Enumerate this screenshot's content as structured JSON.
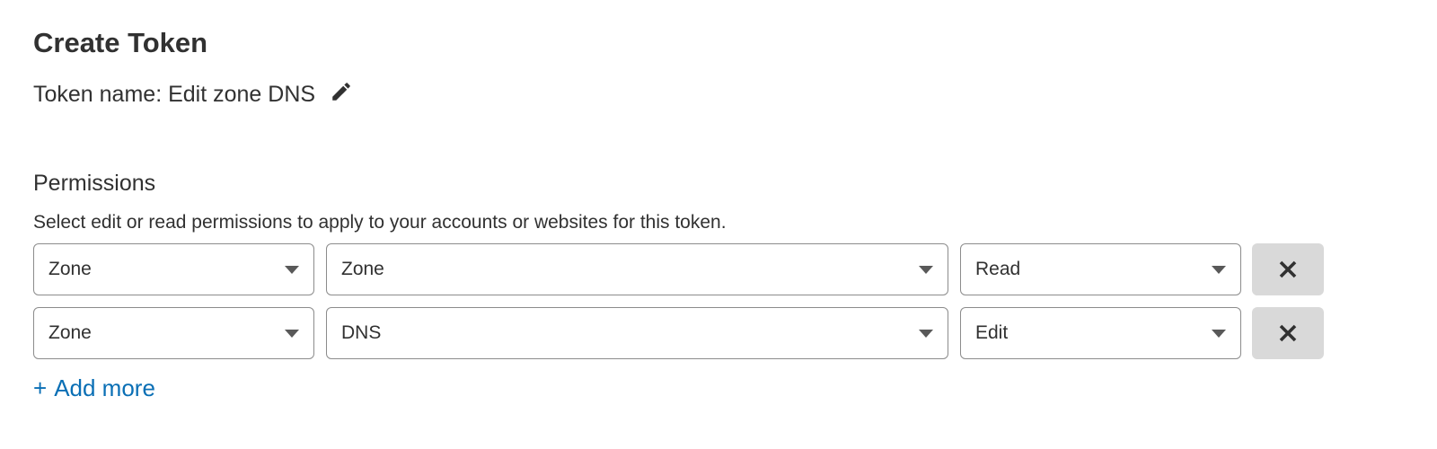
{
  "header": {
    "title": "Create Token"
  },
  "token_name": {
    "prefix": "Token name: ",
    "value": "Edit zone DNS",
    "edit_icon": "pencil-icon"
  },
  "permissions": {
    "title": "Permissions",
    "description": "Select edit or read permissions to apply to your accounts or websites for this token.",
    "rows": [
      {
        "scope": "Zone",
        "resource": "Zone",
        "level": "Read",
        "remove_icon": "close-icon"
      },
      {
        "scope": "Zone",
        "resource": "DNS",
        "level": "Edit",
        "remove_icon": "close-icon"
      }
    ],
    "add_more_plus": "+",
    "add_more_label": "Add more"
  },
  "colors": {
    "text": "#313131",
    "link": "#0a6fb5",
    "border": "#8c8c8c",
    "remove_bg": "#d9d9d9"
  }
}
